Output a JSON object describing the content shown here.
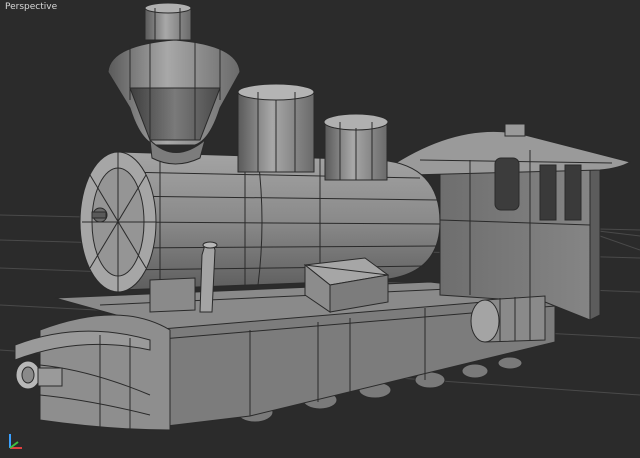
{
  "viewport": {
    "label": "Perspective"
  },
  "scene": {
    "object": "steam-locomotive"
  },
  "gizmo": {
    "axes": "xyz"
  },
  "colors": {
    "background": "#2b2b2b",
    "grid": "#4a4a4a",
    "mesh": "#8e8e8e",
    "wire": "#2a2a2a"
  }
}
